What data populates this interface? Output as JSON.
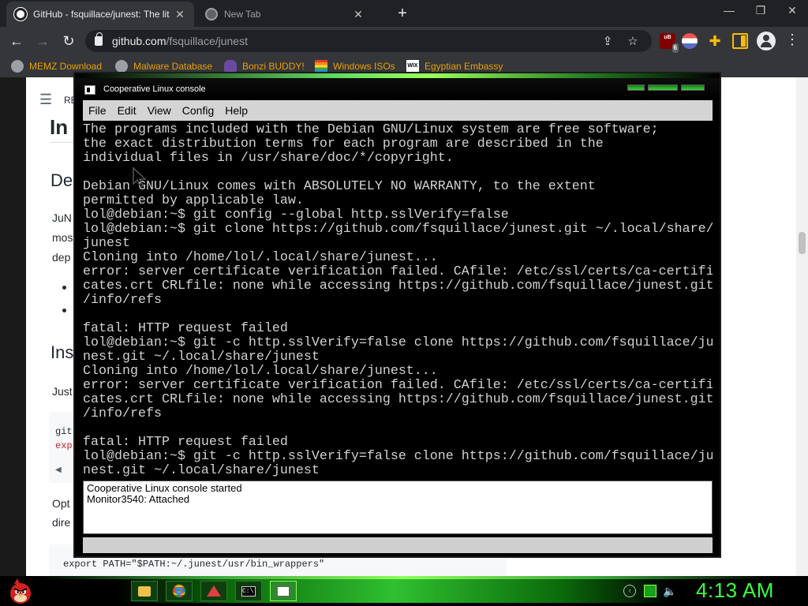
{
  "browser": {
    "tabs": [
      {
        "title": "GitHub - fsquillace/junest: The lit",
        "active": true
      },
      {
        "title": "New Tab",
        "active": false
      }
    ],
    "new_tab_label": "+",
    "url_host": "github.com",
    "url_path": "/fsquillace/junest",
    "extension_badge": "6",
    "bookmarks": [
      "MEMZ Download",
      "Malware Database",
      "Bonzi BUDDY!",
      "Windows ISOs",
      "Egyptian Embassy"
    ]
  },
  "github_page": {
    "menu_fragment": "RE",
    "heading_fragment_1": "In",
    "heading_fragment_2": "De",
    "para_fragments": [
      "JuN",
      "mos",
      "dep"
    ],
    "heading_fragment_3": "Ins",
    "just_fragment": "Just",
    "code_fragments": [
      "git",
      "exp"
    ],
    "opt_fragments": [
      "Opt",
      "dire"
    ],
    "export_line": "export PATH=\"$PATH:~/.junest/usr/bin_wrappers\""
  },
  "colinux": {
    "title": "Cooperative Linux console",
    "menus": [
      "File",
      "Edit",
      "View",
      "Config",
      "Help"
    ],
    "terminal_lines": [
      "The programs included with the Debian GNU/Linux system are free software;",
      "the exact distribution terms for each program are described in the",
      "individual files in /usr/share/doc/*/copyright.",
      "",
      "Debian GNU/Linux comes with ABSOLUTELY NO WARRANTY, to the extent",
      "permitted by applicable law.",
      "lol@debian:~$ git config --global http.sslVerify=false",
      "lol@debian:~$ git clone https://github.com/fsquillace/junest.git ~/.local/share/",
      "junest",
      "Cloning into /home/lol/.local/share/junest...",
      "error: server certificate verification failed. CAfile: /etc/ssl/certs/ca-certifi",
      "cates.crt CRLfile: none while accessing https://github.com/fsquillace/junest.git",
      "/info/refs",
      "",
      "fatal: HTTP request failed",
      "lol@debian:~$ git -c http.sslVerify=false clone https://github.com/fsquillace/ju",
      "nest.git ~/.local/share/junest",
      "Cloning into /home/lol/.local/share/junest...",
      "error: server certificate verification failed. CAfile: /etc/ssl/certs/ca-certifi",
      "cates.crt CRLfile: none while accessing https://github.com/fsquillace/junest.git",
      "/info/refs",
      "",
      "fatal: HTTP request failed",
      "lol@debian:~$ git -c http.sslVerify=false clone https://github.com/fsquillace/ju",
      "nest.git ~/.local/share/junest"
    ],
    "log_lines": [
      "Cooperative Linux console started",
      "Monitor3540: Attached"
    ]
  },
  "taskbar": {
    "clock": "4:13 AM",
    "items": [
      "file-explorer",
      "chrome",
      "colinux-daemon",
      "command-prompt",
      "colinux-console"
    ]
  },
  "colors": {
    "terminal_bg": "#000000",
    "terminal_fg": "#d2d2d2",
    "clock": "#3cff3c",
    "bookmark_text": "#e8a000"
  }
}
